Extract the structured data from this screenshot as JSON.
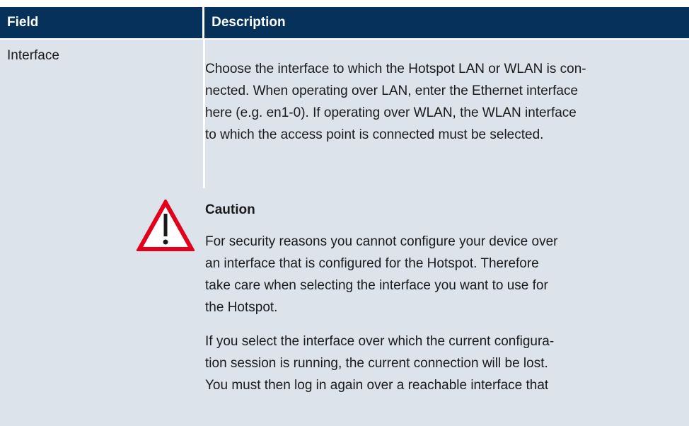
{
  "table": {
    "headers": [
      "Field",
      "Description"
    ],
    "rows": [
      {
        "field": "Interface",
        "description_lines": [
          "Choose the interface to which the Hotspot LAN or WLAN is con-",
          "nected. When operating over LAN, enter the Ethernet interface",
          "here (e.g. en1-0). If operating over WLAN, the WLAN interface",
          "to which the access point is connected must be selected."
        ]
      }
    ]
  },
  "caution": {
    "icon": "warning-triangle-icon",
    "title": "Caution",
    "paragraph1_lines": [
      "For security reasons you cannot configure your device over",
      "an interface that is configured for the Hotspot. Therefore",
      "take care when selecting the interface you want to use for",
      "the Hotspot."
    ],
    "paragraph2_lines": [
      "If you select the interface over which the current configura-",
      "tion session is running, the current connection will be lost.",
      "You must then log in again over a reachable interface that"
    ]
  },
  "colors": {
    "header_bg": "#05315a",
    "body_bg": "#dde3ea",
    "warning_red": "#e3001b"
  }
}
